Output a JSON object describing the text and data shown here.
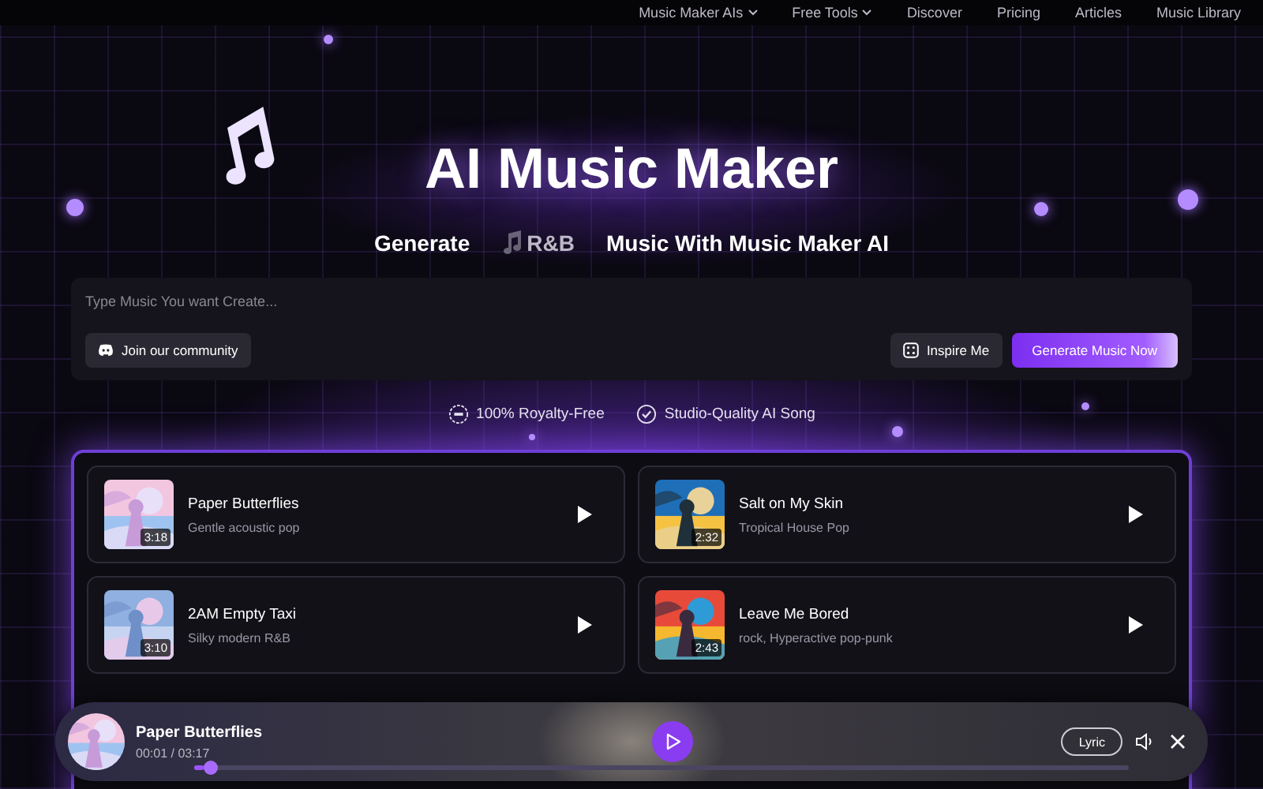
{
  "nav": [
    {
      "label": "Music Maker AIs",
      "dropdown": true
    },
    {
      "label": "Free Tools",
      "dropdown": true
    },
    {
      "label": "Discover",
      "dropdown": false
    },
    {
      "label": "Pricing",
      "dropdown": false
    },
    {
      "label": "Articles",
      "dropdown": false
    },
    {
      "label": "Music Library",
      "dropdown": false
    }
  ],
  "hero": {
    "title": "AI Music Maker",
    "subtitle_before": "Generate",
    "genre": "R&B",
    "subtitle_after": "Music With Music Maker AI"
  },
  "prompt": {
    "placeholder": "Type Music You want Create...",
    "community_button": "Join our community",
    "inspire_button": "Inspire Me",
    "generate_button": "Generate Music Now"
  },
  "features": [
    "100% Royalty-Free",
    "Studio-Quality AI Song"
  ],
  "songs": [
    {
      "title": "Paper Butterflies",
      "style": "Gentle acoustic pop",
      "duration": "3:18"
    },
    {
      "title": "Salt on My Skin",
      "style": "Tropical House Pop",
      "duration": "2:32"
    },
    {
      "title": "2AM Empty Taxi",
      "style": "Silky modern R&B",
      "duration": "3:10"
    },
    {
      "title": "Leave Me Bored",
      "style": "rock, Hyperactive pop-punk",
      "duration": "2:43"
    }
  ],
  "player": {
    "title": "Paper Butterflies",
    "time": "00:01 / 03:17",
    "level": 0.01,
    "lyric_button": "Lyric"
  }
}
